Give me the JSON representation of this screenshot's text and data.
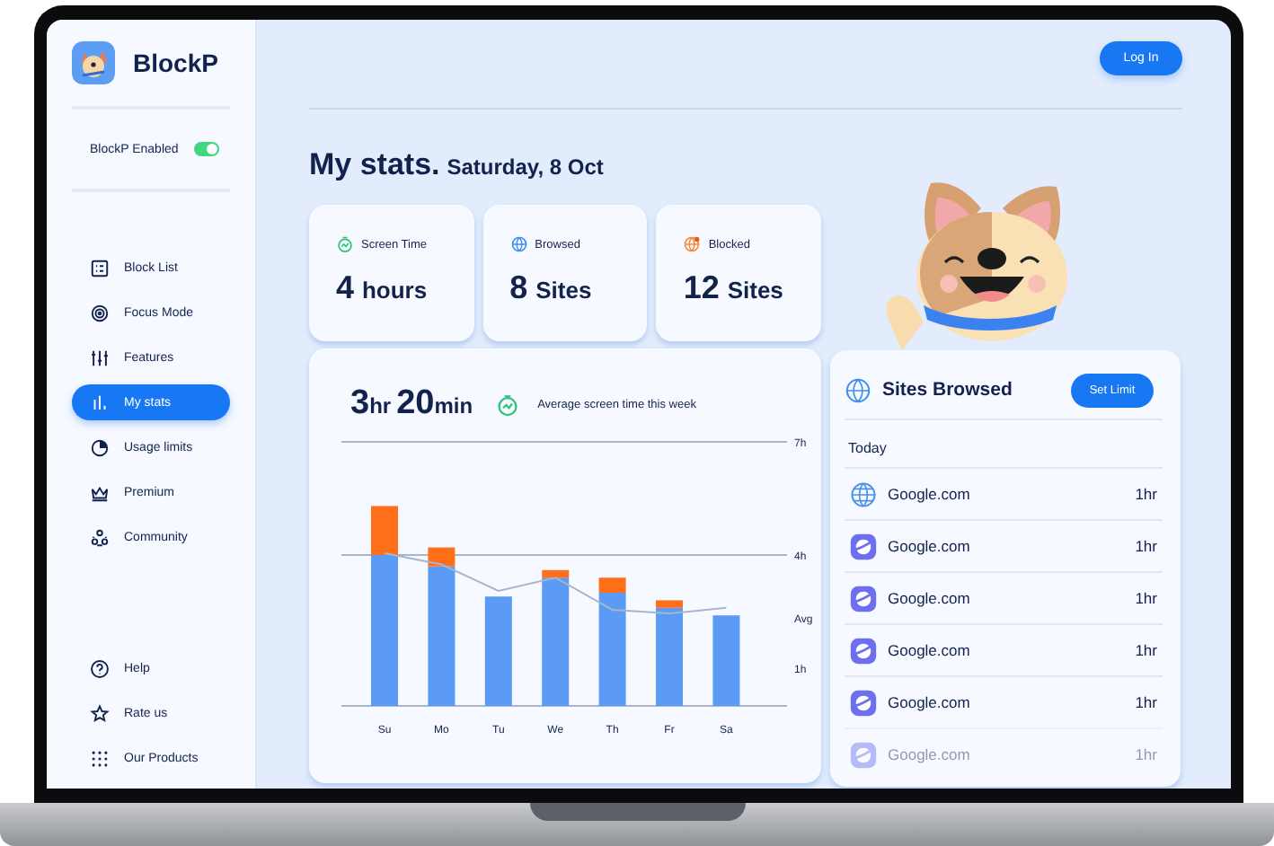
{
  "sidebar": {
    "app_name": "BlockP",
    "toggle": {
      "label": "BlockP Enabled",
      "on": true
    },
    "nav": [
      {
        "label": "Block List",
        "kind": "list",
        "selected": false
      },
      {
        "label": "Focus Mode",
        "kind": "target",
        "selected": false
      },
      {
        "label": "Features",
        "kind": "sliders",
        "selected": false
      },
      {
        "label": "My stats",
        "kind": "bars",
        "selected": true
      },
      {
        "label": "Usage limits",
        "kind": "pie",
        "selected": false
      },
      {
        "label": "Premium",
        "kind": "crown",
        "selected": false
      },
      {
        "label": "Community",
        "kind": "people",
        "selected": false
      }
    ],
    "footer": [
      {
        "label": "Help",
        "kind": "help"
      },
      {
        "label": "Rate us",
        "kind": "star"
      },
      {
        "label": "Our Products",
        "kind": "grid"
      }
    ]
  },
  "header": {
    "login_button": "Log In"
  },
  "page_title": {
    "title": "My stats.",
    "date": "Saturday, 8 Oct"
  },
  "stat_cards": [
    {
      "kind": "timer",
      "label": "Screen Time",
      "value": "4",
      "unit": "hours"
    },
    {
      "kind": "globe",
      "label": "Browsed",
      "value": "8",
      "unit": "Sites"
    },
    {
      "kind": "blocked",
      "label": "Blocked",
      "value": "12",
      "unit": "Sites"
    }
  ],
  "weekly_chart": {
    "average_time": [
      {
        "value": "3",
        "unit": "hr"
      },
      {
        "value": "20",
        "unit": "min"
      }
    ],
    "caption": "Average screen time this week",
    "chart_data": {
      "type": "bar",
      "stacked": true,
      "categories": [
        "Su",
        "Mo",
        "Tu",
        "We",
        "Th",
        "Fr",
        "Sa"
      ],
      "ylim": [
        0,
        7
      ],
      "yticks": [
        {
          "value": 7,
          "label": "7h"
        },
        {
          "value": 4,
          "label": "4h"
        },
        {
          "value": 2.33,
          "label": "Avg"
        },
        {
          "value": 1,
          "label": "1h"
        }
      ],
      "series": [
        {
          "color": "#5b9bf5",
          "values": [
            4.0,
            3.7,
            2.9,
            3.4,
            3.0,
            2.6,
            2.4
          ]
        },
        {
          "color": "#ff6f1a",
          "values": [
            1.3,
            0.5,
            0,
            0.2,
            0.4,
            0.2,
            0
          ]
        },
        {
          "type": "line",
          "color": "#a7b6cc",
          "values": [
            4.05,
            3.75,
            3.05,
            3.4,
            2.55,
            2.45,
            2.6
          ]
        }
      ]
    }
  },
  "sites_browsed": {
    "title": "Sites Browsed",
    "button": "Set Limit",
    "section": "Today",
    "rows": [
      {
        "kind": "globe",
        "site": "Google.com",
        "time": "1hr"
      },
      {
        "kind": "planet",
        "site": "Google.com",
        "time": "1hr"
      },
      {
        "kind": "planet",
        "site": "Google.com",
        "time": "1hr"
      },
      {
        "kind": "planet",
        "site": "Google.com",
        "time": "1hr"
      },
      {
        "kind": "planet",
        "site": "Google.com",
        "time": "1hr"
      },
      {
        "kind": "planet",
        "site": "Google.com",
        "time": "1hr"
      }
    ]
  }
}
